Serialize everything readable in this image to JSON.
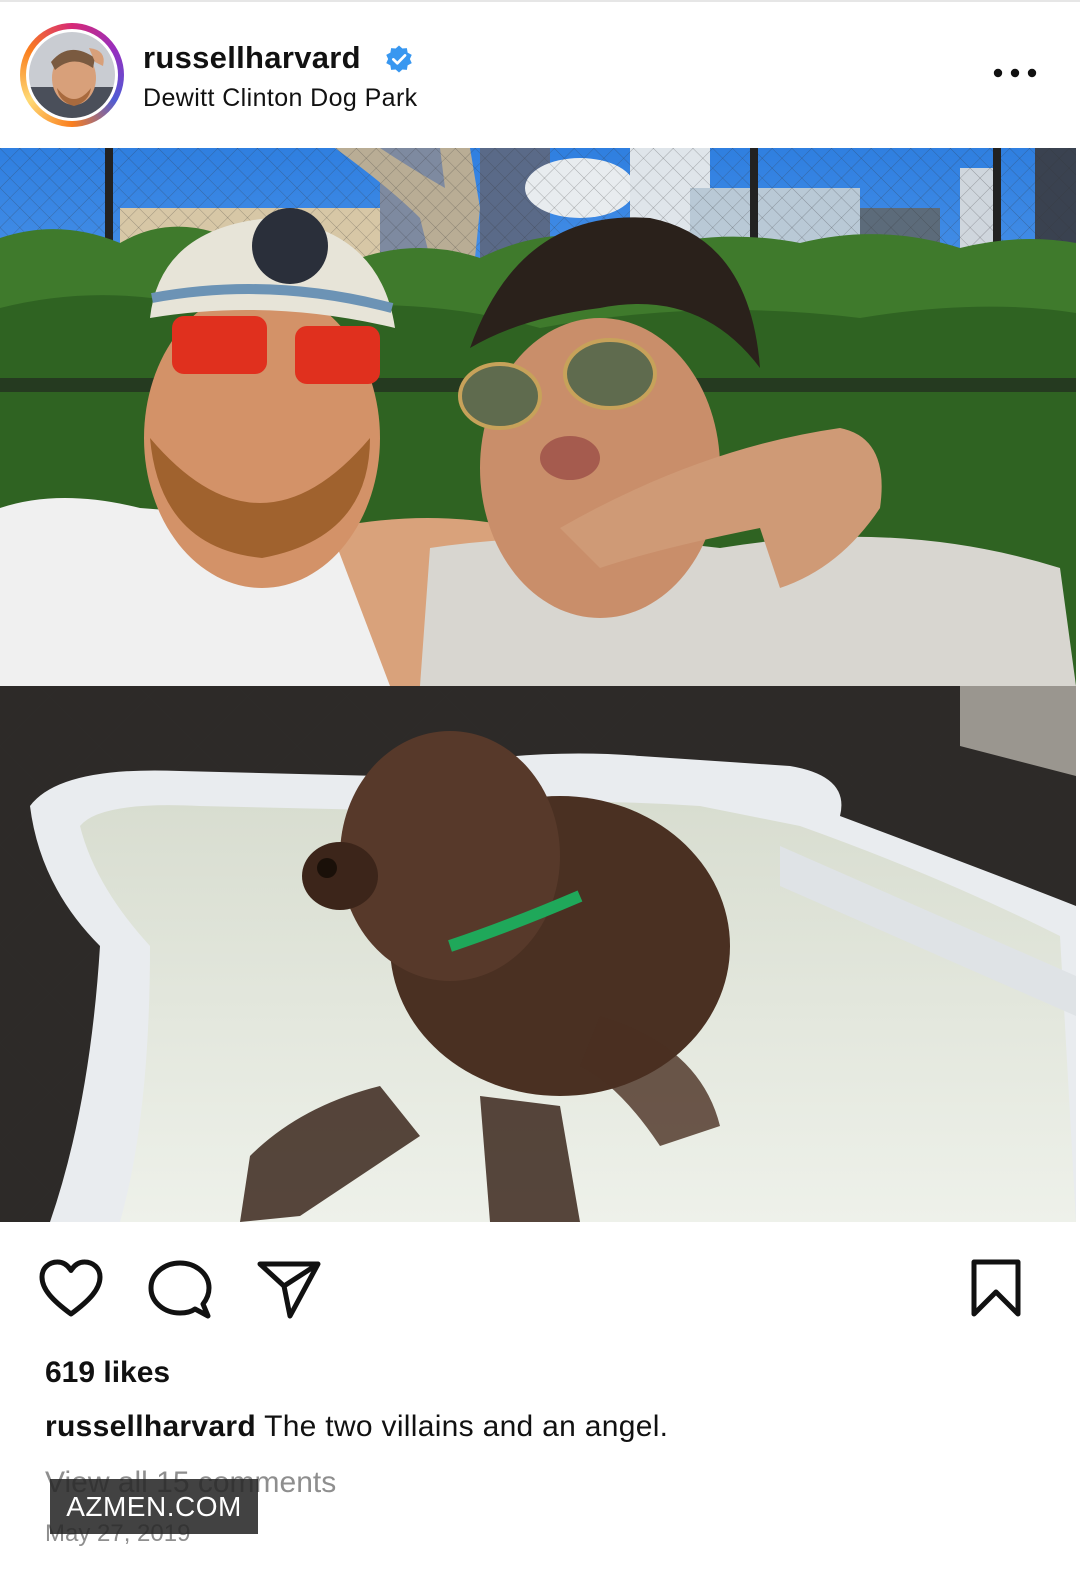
{
  "post": {
    "username": "russellharvard",
    "location": "Dewitt Clinton Dog Park",
    "likes_text": "619 likes",
    "caption_username": "russellharvard",
    "caption_text": " The two villains and an angel.",
    "view_comments": "View all 15 comments",
    "date": "May 27, 2019",
    "verified": true
  },
  "icons": {
    "verified": "verified-badge-icon",
    "more": "more-options-icon",
    "like": "heart-icon",
    "comment": "comment-bubble-icon",
    "share": "paper-plane-icon",
    "save": "bookmark-icon"
  },
  "watermark": {
    "text": "AZMEN.COM"
  },
  "colors": {
    "verified_blue": "#3897f0",
    "muted": "#8e8e8e",
    "text": "#111111"
  }
}
